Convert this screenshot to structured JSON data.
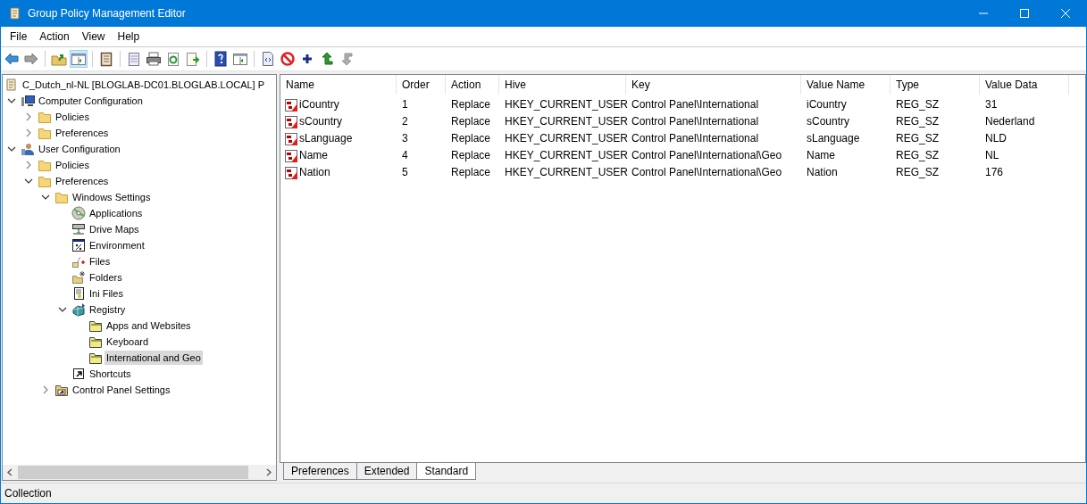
{
  "window": {
    "title": "Group Policy Management Editor"
  },
  "menu": [
    "File",
    "Action",
    "View",
    "Help"
  ],
  "toolbar": [
    {
      "kind": "back",
      "disabled": false,
      "pressed": false
    },
    {
      "kind": "forward",
      "disabled": true,
      "pressed": false
    },
    {
      "kind": "sep"
    },
    {
      "kind": "up",
      "disabled": false,
      "pressed": false
    },
    {
      "kind": "pane",
      "disabled": false,
      "pressed": true
    },
    {
      "kind": "sep"
    },
    {
      "kind": "clipboard",
      "disabled": false,
      "pressed": false
    },
    {
      "kind": "sep"
    },
    {
      "kind": "properties",
      "disabled": false,
      "pressed": false
    },
    {
      "kind": "print",
      "disabled": false,
      "pressed": false
    },
    {
      "kind": "refresh",
      "disabled": false,
      "pressed": false
    },
    {
      "kind": "export",
      "disabled": false,
      "pressed": false
    },
    {
      "kind": "sep"
    },
    {
      "kind": "help",
      "disabled": false,
      "pressed": false
    },
    {
      "kind": "pane",
      "disabled": false,
      "pressed": false
    },
    {
      "kind": "sep"
    },
    {
      "kind": "xml",
      "disabled": false,
      "pressed": false
    },
    {
      "kind": "stop",
      "disabled": false,
      "pressed": false
    },
    {
      "kind": "add",
      "disabled": false,
      "pressed": false
    },
    {
      "kind": "moveup",
      "disabled": false,
      "pressed": false
    },
    {
      "kind": "movedown",
      "disabled": true,
      "pressed": false
    }
  ],
  "tree": {
    "label": "C_Dutch_nl-NL [BLOGLAB-DC01.BLOGLAB.LOCAL] P",
    "kind": "scroll",
    "selected": false,
    "children": [
      {
        "label": "Computer Configuration",
        "kind": "computer",
        "expanded": true,
        "selected": false,
        "children": [
          {
            "label": "Policies",
            "kind": "folder",
            "expanded": false,
            "selected": false
          },
          {
            "label": "Preferences",
            "kind": "folder",
            "expanded": false,
            "selected": false
          }
        ]
      },
      {
        "label": "User Configuration",
        "kind": "user",
        "expanded": true,
        "selected": false,
        "children": [
          {
            "label": "Policies",
            "kind": "folder",
            "expanded": false,
            "selected": false
          },
          {
            "label": "Preferences",
            "kind": "folder",
            "expanded": true,
            "selected": false,
            "children": [
              {
                "label": "Windows Settings",
                "kind": "folder",
                "expanded": true,
                "selected": false,
                "children": [
                  {
                    "label": "Applications",
                    "kind": "disc",
                    "selected": false
                  },
                  {
                    "label": "Drive Maps",
                    "kind": "drive",
                    "selected": false
                  },
                  {
                    "label": "Environment",
                    "kind": "percent",
                    "selected": false
                  },
                  {
                    "label": "Files",
                    "kind": "file",
                    "selected": false
                  },
                  {
                    "label": "Folders",
                    "kind": "newfolder",
                    "selected": false
                  },
                  {
                    "label": "Ini Files",
                    "kind": "ini",
                    "selected": false
                  },
                  {
                    "label": "Registry",
                    "kind": "registry",
                    "expanded": true,
                    "selected": false,
                    "children": [
                      {
                        "label": "Apps and Websites",
                        "kind": "regfolder",
                        "selected": false
                      },
                      {
                        "label": "Keyboard",
                        "kind": "regfolder",
                        "selected": false
                      },
                      {
                        "label": "International and Geo",
                        "kind": "regfolder",
                        "selected": true
                      }
                    ]
                  },
                  {
                    "label": "Shortcuts",
                    "kind": "shortcut",
                    "selected": false
                  }
                ]
              },
              {
                "label": "Control Panel Settings",
                "kind": "cpanel",
                "expanded": false,
                "selected": false
              }
            ]
          }
        ]
      }
    ]
  },
  "table": {
    "columns": [
      "Name",
      "Order",
      "Action",
      "Hive",
      "Key",
      "Value Name",
      "Type",
      "Value Data"
    ],
    "rows": [
      [
        "iCountry",
        "1",
        "Replace",
        "HKEY_CURRENT_USER",
        "Control Panel\\International",
        "iCountry",
        "REG_SZ",
        "31"
      ],
      [
        "sCountry",
        "2",
        "Replace",
        "HKEY_CURRENT_USER",
        "Control Panel\\International",
        "sCountry",
        "REG_SZ",
        "Nederland"
      ],
      [
        "sLanguage",
        "3",
        "Replace",
        "HKEY_CURRENT_USER",
        "Control Panel\\International",
        "sLanguage",
        "REG_SZ",
        "NLD"
      ],
      [
        "Name",
        "4",
        "Replace",
        "HKEY_CURRENT_USER",
        "Control Panel\\International\\Geo",
        "Name",
        "REG_SZ",
        "NL"
      ],
      [
        "Nation",
        "5",
        "Replace",
        "HKEY_CURRENT_USER",
        "Control Panel\\International\\Geo",
        "Nation",
        "REG_SZ",
        "176"
      ]
    ]
  },
  "tabs": [
    {
      "label": "Preferences",
      "selected": false
    },
    {
      "label": "Extended",
      "selected": false
    },
    {
      "label": "Standard",
      "selected": true
    }
  ],
  "status_bar": "Collection"
}
